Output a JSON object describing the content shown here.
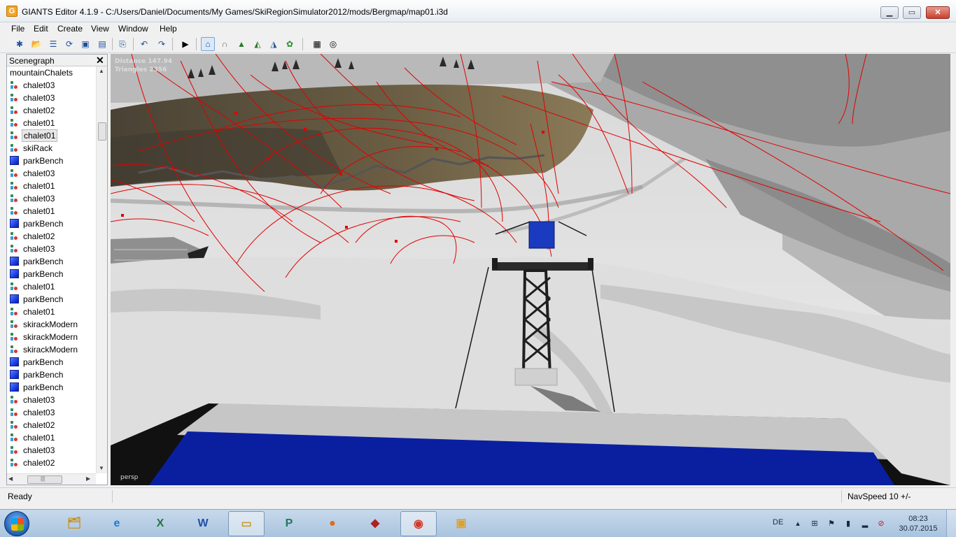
{
  "window": {
    "title": "GIANTS Editor 4.1.9 - C:/Users/Daniel/Documents/My Games/SkiRegionSimulator2012/mods/Bergmap/map01.i3d",
    "minimize": "▁",
    "maximize": "▭",
    "close": "✕"
  },
  "menu": [
    "File",
    "Edit",
    "Create",
    "View",
    "Window",
    "Help"
  ],
  "toolbar": {
    "icons": [
      "new-icon",
      "open-icon",
      "script-icon",
      "reload-icon",
      "save-icon",
      "save-as-icon",
      "import-icon",
      "undo-icon",
      "redo-icon",
      "play-icon",
      "home-icon",
      "magnet-icon",
      "terrain-raise-icon",
      "terrain-smooth-icon",
      "terrain-paint-icon",
      "foliage-icon",
      "checker-icon",
      "checker-settings-icon"
    ]
  },
  "scenegraph": {
    "title": "Scenegraph",
    "close": "✕",
    "root": "mountainChalets",
    "items": [
      {
        "label": "chalet03",
        "icon": "mesh"
      },
      {
        "label": "chalet03",
        "icon": "mesh"
      },
      {
        "label": "chalet02",
        "icon": "mesh"
      },
      {
        "label": "chalet01",
        "icon": "mesh"
      },
      {
        "label": "chalet01",
        "icon": "mesh",
        "selected": true
      },
      {
        "label": "skiRack",
        "icon": "mesh"
      },
      {
        "label": "parkBench",
        "icon": "cube"
      },
      {
        "label": "chalet03",
        "icon": "mesh"
      },
      {
        "label": "chalet01",
        "icon": "mesh"
      },
      {
        "label": "chalet03",
        "icon": "mesh"
      },
      {
        "label": "chalet01",
        "icon": "mesh"
      },
      {
        "label": "parkBench",
        "icon": "cube"
      },
      {
        "label": "chalet02",
        "icon": "mesh"
      },
      {
        "label": "chalet03",
        "icon": "mesh"
      },
      {
        "label": "parkBench",
        "icon": "cube"
      },
      {
        "label": "parkBench",
        "icon": "cube"
      },
      {
        "label": "chalet01",
        "icon": "mesh"
      },
      {
        "label": "parkBench",
        "icon": "cube"
      },
      {
        "label": "chalet01",
        "icon": "mesh"
      },
      {
        "label": "skirackModern",
        "icon": "mesh"
      },
      {
        "label": "skirackModern",
        "icon": "mesh"
      },
      {
        "label": "skirackModern",
        "icon": "mesh"
      },
      {
        "label": "parkBench",
        "icon": "cube"
      },
      {
        "label": "parkBench",
        "icon": "cube"
      },
      {
        "label": "parkBench",
        "icon": "cube"
      },
      {
        "label": "chalet03",
        "icon": "mesh"
      },
      {
        "label": "chalet03",
        "icon": "mesh"
      },
      {
        "label": "chalet02",
        "icon": "mesh"
      },
      {
        "label": "chalet01",
        "icon": "mesh"
      },
      {
        "label": "chalet03",
        "icon": "mesh"
      },
      {
        "label": "chalet02",
        "icon": "mesh"
      }
    ],
    "hscroll_label": "|||"
  },
  "viewport": {
    "distance_label": "Distance 147.94",
    "triangles_label": "Triangles 2356",
    "camera_label": "persp"
  },
  "status": {
    "left": "Ready",
    "right": "NavSpeed 10 +/-"
  },
  "taskbar": {
    "apps": [
      "start",
      "games-folder",
      "internet-explorer",
      "excel",
      "word",
      "file-explorer",
      "publisher",
      "firefox",
      "racing-game",
      "chrome",
      "giants-editor"
    ],
    "active_apps": [
      "file-explorer",
      "chrome"
    ],
    "language": "DE",
    "time": "08:23",
    "date": "30.07.2015"
  },
  "colors": {
    "spline_red": "#e10000",
    "lift_blue": "#0a1fa0",
    "selection": "#e8e8e8"
  }
}
